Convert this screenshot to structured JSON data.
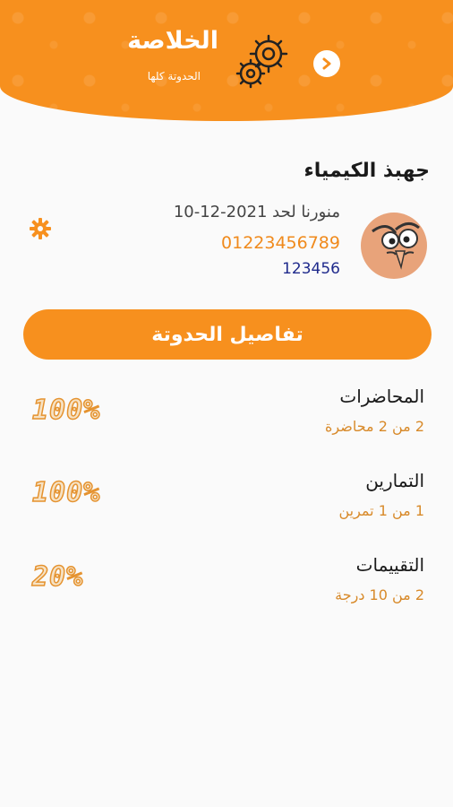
{
  "header": {
    "title": "الخلاصة",
    "subtitle": "الحدوتة كلها",
    "gear_icon": "gears-icon",
    "back_icon": "chevron-right-icon",
    "bg_color": "#f7901e"
  },
  "profile": {
    "center_name": "جهبذ الكيمياء",
    "renew_text": "منورنا لحد 2021-12-10",
    "phone": "01223456789",
    "code": "123456",
    "avatar_icon": "cartoon-face-avatar",
    "settings_icon": "gear-icon"
  },
  "details_button": {
    "label": "تفاصيل الحدوتة"
  },
  "stats": [
    {
      "title": "المحاضرات",
      "detail": "2 من 2 محاضرة",
      "percent": "100%"
    },
    {
      "title": "التمارين",
      "detail": "1 من 1 تمرين",
      "percent": "100%"
    },
    {
      "title": "التقييمات",
      "detail": "2 من 10 درجة",
      "percent": "20%"
    }
  ],
  "colors": {
    "accent": "#f7901e",
    "phone": "#f08a1c",
    "code": "#1f2a8c",
    "detail": "#d88a2a"
  }
}
